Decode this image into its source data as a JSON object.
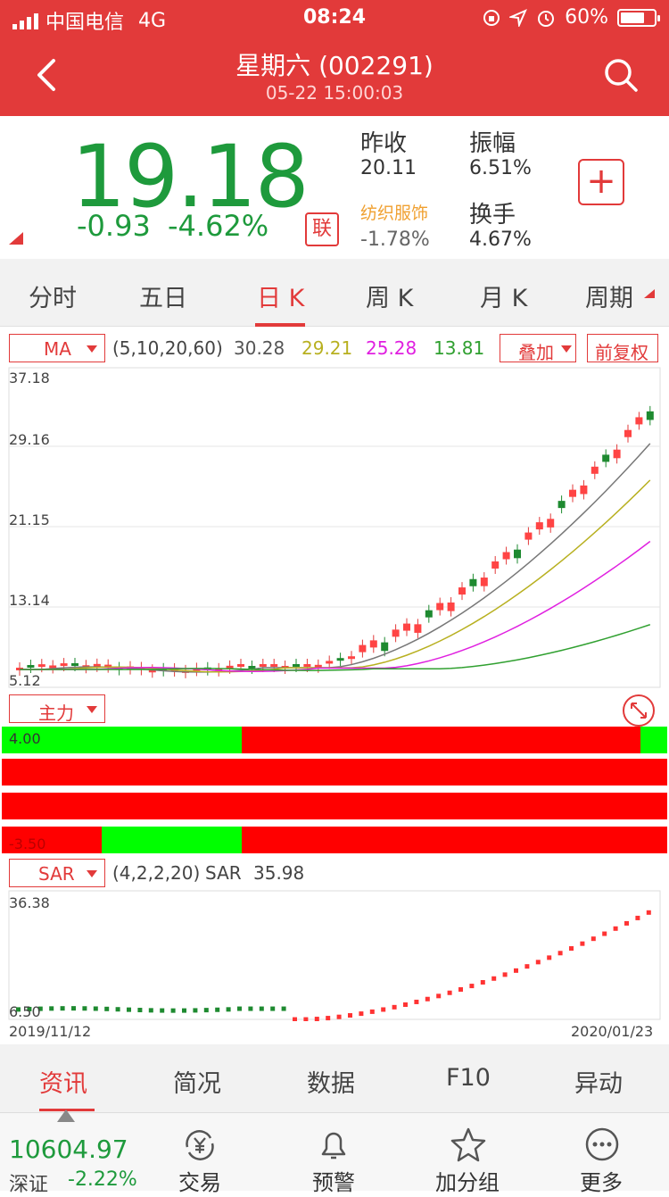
{
  "status_bar": {
    "carrier": "中国电信",
    "network": "4G",
    "time": "08:24",
    "battery": "60%"
  },
  "header": {
    "title": "星期六 (002291)",
    "subtitle": "05-22 15:00:03"
  },
  "quote": {
    "price": "19.18",
    "change": "-0.93",
    "change_pct": "-4.62%",
    "lian_label": "联",
    "prev_close_label": "昨收",
    "prev_close": "20.11",
    "amplitude_label": "振幅",
    "amplitude": "6.51%",
    "sector_label": "纺织服饰",
    "sector_change": "-1.78%",
    "turnover_label": "换手",
    "turnover": "4.67%"
  },
  "chart_tabs": [
    "分时",
    "五日",
    "日 K",
    "周 K",
    "月 K",
    "周期"
  ],
  "ma": {
    "selector": "MA",
    "params": "(5,10,20,60)",
    "values": [
      "30.28",
      "29.21",
      "25.28",
      "13.81"
    ],
    "overlay": "叠加",
    "adjust": "前复权",
    "colors": [
      "#666666",
      "#b8b020",
      "#e020e0",
      "#30a030"
    ]
  },
  "kline_axis": [
    "37.18",
    "29.16",
    "21.15",
    "13.14",
    "5.12"
  ],
  "main_force": {
    "selector": "主力",
    "top": "4.00",
    "bottom": "-3.50"
  },
  "sar": {
    "selector": "SAR",
    "params": "(4,2,2,20)",
    "label": "SAR",
    "value": "35.98",
    "axis_top": "36.38",
    "axis_bottom": "6.50"
  },
  "dates": {
    "start": "2019/11/12",
    "end": "2020/01/23"
  },
  "bottom_tabs": [
    "资讯",
    "简况",
    "数据",
    "F10",
    "异动"
  ],
  "index": {
    "value": "10604.97",
    "name": "深证",
    "change": "-2.22%"
  },
  "toolbar": {
    "trade": "交易",
    "alert": "预警",
    "group": "加分组",
    "more": "更多"
  }
}
